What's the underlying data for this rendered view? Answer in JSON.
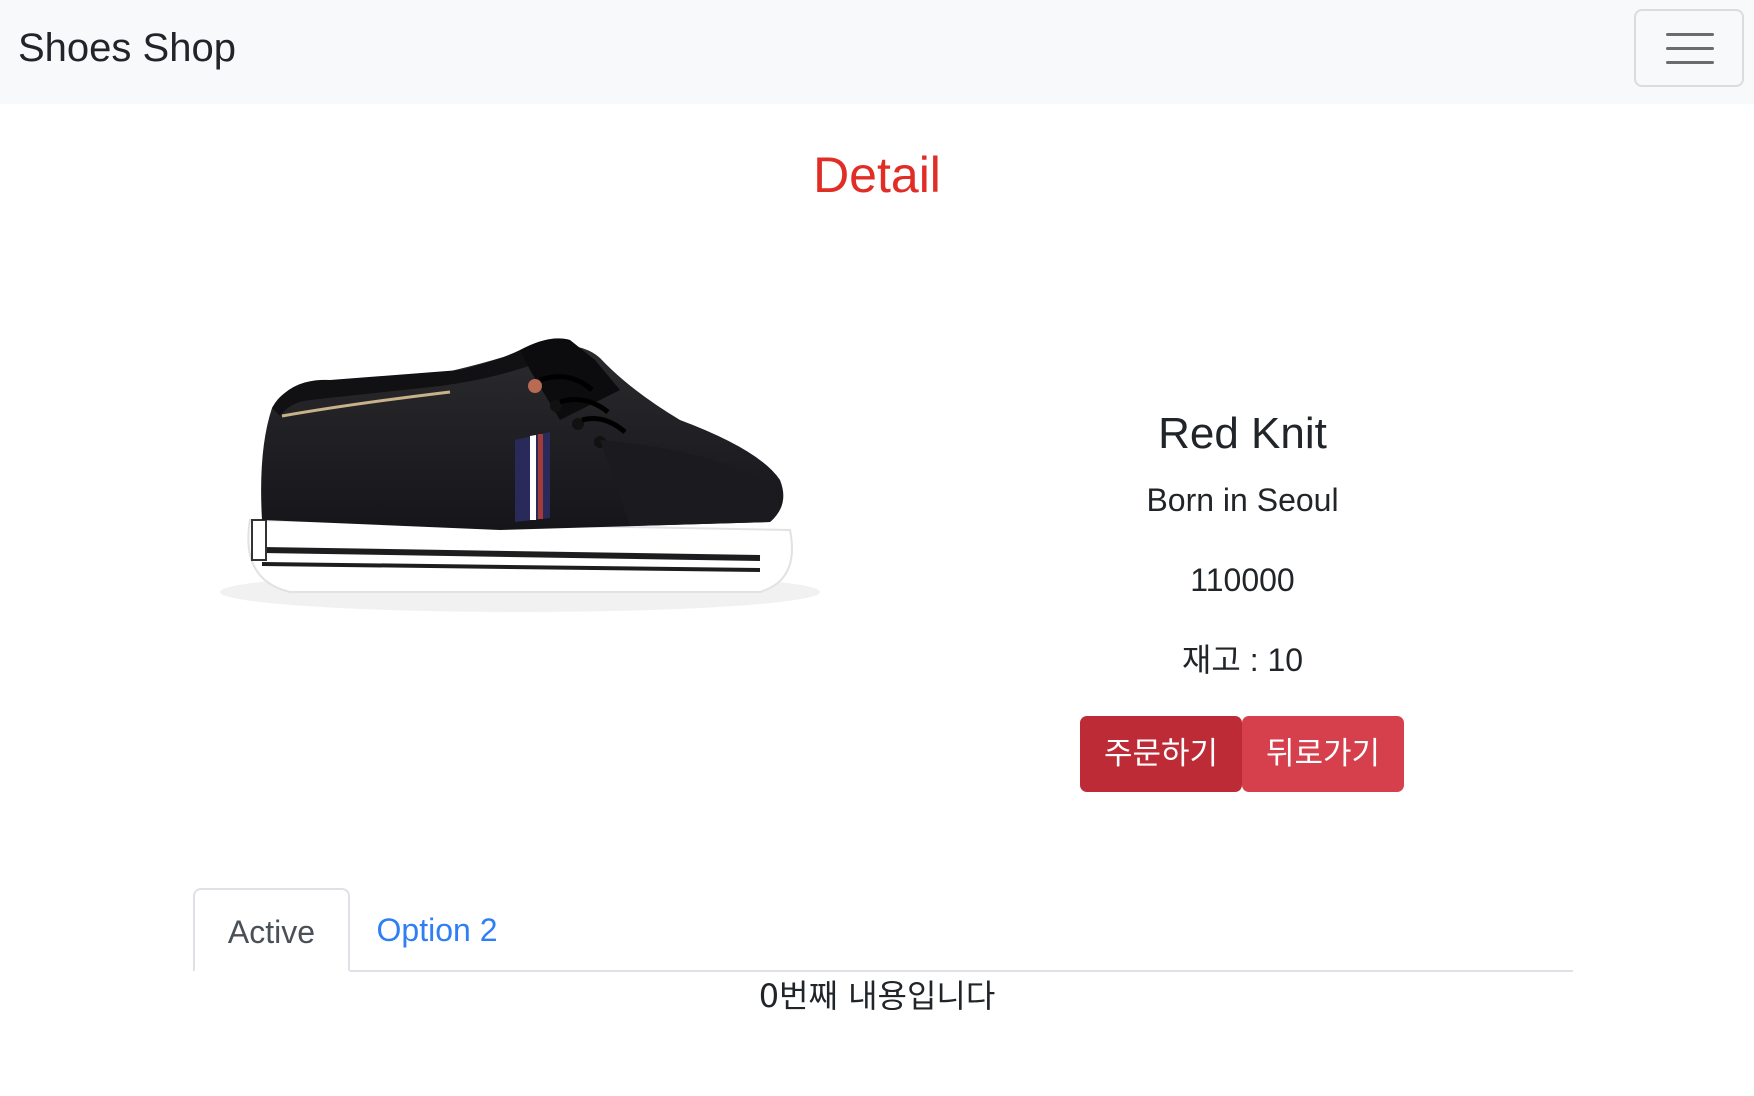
{
  "navbar": {
    "brand": "Shoes Shop",
    "toggler_icon": "hamburger-menu-icon"
  },
  "page": {
    "title": "Detail",
    "title_color": "#e02d25"
  },
  "product": {
    "image": "black-sneaker-image",
    "name": "Red Knit",
    "description": "Born in Seoul",
    "price": "110000",
    "stock": "재고 : 10"
  },
  "actions": {
    "order_label": "주문하기",
    "back_label": "뒤로가기",
    "order_color": "#bd2c36",
    "back_color": "#d6404d"
  },
  "tabs": {
    "items": [
      {
        "label": "Active",
        "active": true
      },
      {
        "label": "Option 2",
        "active": false
      }
    ],
    "content": "0번째 내용입니다"
  }
}
